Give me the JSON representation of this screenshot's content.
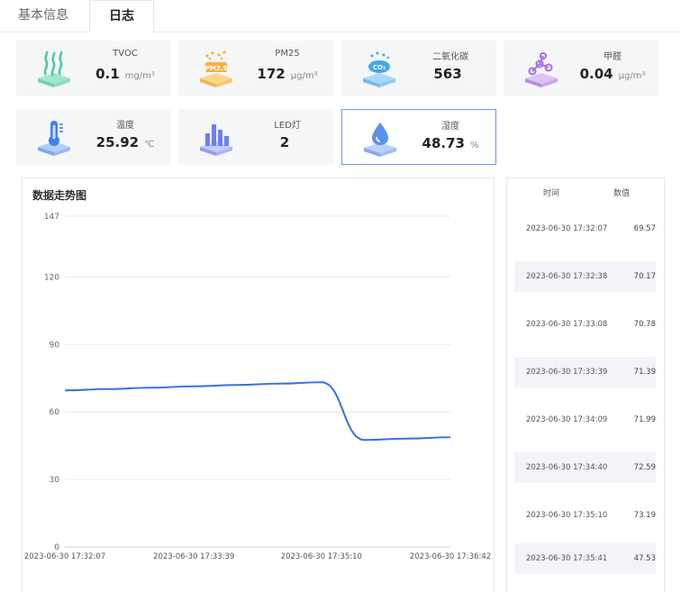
{
  "tabs": [
    {
      "label": "基本信息",
      "active": false
    },
    {
      "label": "日志",
      "active": true
    }
  ],
  "sensors": [
    {
      "label": "TVOC",
      "value": "0.1",
      "unit": "mg/m³",
      "icon": "waves-icon",
      "color": "#4cc9a0"
    },
    {
      "label": "PM25",
      "value": "172",
      "unit": "μg/m³",
      "icon": "pm25-icon",
      "color": "#f5b042"
    },
    {
      "label": "二氧化碳",
      "value": "563",
      "unit": "",
      "icon": "co2-icon",
      "color": "#3fa7ef"
    },
    {
      "label": "甲醛",
      "value": "0.04",
      "unit": "μg/m³",
      "icon": "molecule-icon",
      "color": "#a66de0"
    },
    {
      "label": "温度",
      "value": "25.92",
      "unit": "℃",
      "icon": "thermometer-icon",
      "color": "#3f80ef"
    },
    {
      "label": "LED灯",
      "value": "2",
      "unit": "",
      "icon": "bars-icon",
      "color": "#6a7ff0"
    },
    {
      "label": "湿度",
      "value": "48.73",
      "unit": "%",
      "icon": "droplet-icon",
      "color": "#5b8ff0",
      "selected": true
    }
  ],
  "chart_data": {
    "type": "line",
    "title": "数据走势图",
    "x": [
      "2023-06-30 17:32:07",
      "2023-06-30 17:33:39",
      "2023-06-30 17:35:10",
      "2023-06-30 17:36:42"
    ],
    "x_ticks": [
      "2023-06-30 17:32:07",
      "2023-06-30 17:33:39",
      "2023-06-30 17:35:10",
      "2023-06-30 17:36:42"
    ],
    "y_ticks": [
      0,
      30,
      60,
      90,
      120,
      147
    ],
    "ylim": [
      0,
      147
    ],
    "grid": true,
    "line_color": "#3b6fe0",
    "series": [
      {
        "points": [
          [
            "2023-06-30 17:32:07",
            69.57
          ],
          [
            "2023-06-30 17:32:38",
            70.17
          ],
          [
            "2023-06-30 17:33:08",
            70.78
          ],
          [
            "2023-06-30 17:33:39",
            71.39
          ],
          [
            "2023-06-30 17:34:09",
            71.99
          ],
          [
            "2023-06-30 17:34:40",
            72.59
          ],
          [
            "2023-06-30 17:35:10",
            73.19
          ],
          [
            "2023-06-30 17:35:41",
            47.53
          ],
          [
            "2023-06-30 17:36:11",
            48.13
          ],
          [
            "2023-06-30 17:36:42",
            48.73
          ]
        ]
      }
    ]
  },
  "log": {
    "headers": [
      "时间",
      "数值"
    ],
    "rows": [
      {
        "time": "2023-06-30 17:32:07",
        "value": "69.57"
      },
      {
        "time": "2023-06-30 17:32:38",
        "value": "70.17"
      },
      {
        "time": "2023-06-30 17:33:08",
        "value": "70.78"
      },
      {
        "time": "2023-06-30 17:33:39",
        "value": "71.39"
      },
      {
        "time": "2023-06-30 17:34:09",
        "value": "71.99"
      },
      {
        "time": "2023-06-30 17:34:40",
        "value": "72.59"
      },
      {
        "time": "2023-06-30 17:35:10",
        "value": "73.19"
      },
      {
        "time": "2023-06-30 17:35:41",
        "value": "47.53"
      }
    ]
  }
}
